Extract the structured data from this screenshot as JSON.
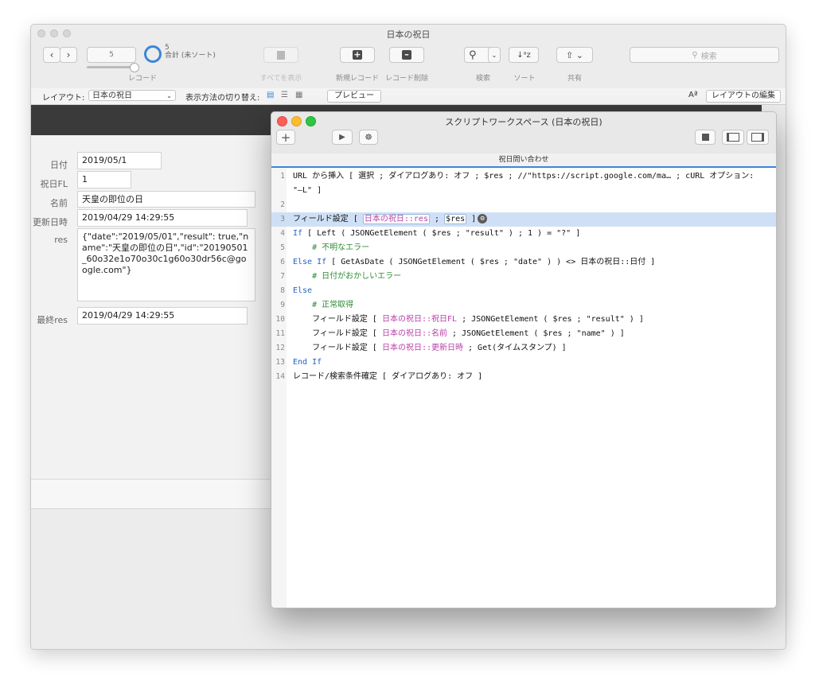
{
  "main_window": {
    "title": "日本の祝日",
    "toolbar": {
      "record_input": "5",
      "record_count": "5",
      "record_sort": "合計 (未ソート)",
      "record_label": "レコード",
      "show_all_label": "すべてを表示",
      "new_record_label": "新規レコード",
      "delete_record_label": "レコード削除",
      "find_label": "検索",
      "sort_label": "ソート",
      "share_label": "共有",
      "search_placeholder": "検索"
    },
    "layout_bar": {
      "layout_label": "レイアウト:",
      "layout_value": "日本の祝日",
      "view_as_label": "表示方法の切り替え:",
      "preview_button": "プレビュー",
      "aa_icon_text": "Aª",
      "edit_layout_button": "レイアウトの編集"
    },
    "form": {
      "date_label": "日付",
      "date_value": "2019/05/1",
      "flag_label": "祝日FL",
      "flag_value": "1",
      "name_label": "名前",
      "name_value": "天皇の即位の日",
      "updated_label": "更新日時",
      "updated_value": "2019/04/29 14:29:55",
      "res_label": "res",
      "res_value": "{\"date\":\"2019/05/01\",\"result\": true,\"name\":\"天皇の即位の日\",\"id\":\"20190501_60o32e1o70o30c1g60o30dr56c@google.com\"}",
      "last_res_label": "最終res",
      "last_res_value": "2019/04/29 14:29:55"
    }
  },
  "script_window": {
    "title": "スクリプトワークスペース (日本の祝日)",
    "tab_label": "祝日問い合わせ",
    "lines": [
      {
        "n": "1",
        "parts": [
          {
            "t": "URL から挿入 [ 選択 ; ダイアログあり: オフ ; $res ; //\"https://script.google.com/ma… ; cURL オプション:",
            "c": ""
          }
        ]
      },
      {
        "n": "",
        "parts": [
          {
            "t": "\"–L\" ]",
            "c": ""
          }
        ]
      },
      {
        "n": "2",
        "parts": []
      },
      {
        "n": "3",
        "parts": [
          {
            "t": "フィールド設定 [ ",
            "c": ""
          },
          {
            "t": "日本の祝日::res",
            "c": "fd box"
          },
          {
            "t": " ; ",
            "c": ""
          },
          {
            "t": "$res",
            "c": "box"
          },
          {
            "t": " ]",
            "c": ""
          }
        ]
      },
      {
        "n": "4",
        "parts": [
          {
            "t": "If",
            "c": "kw"
          },
          {
            "t": " [ Left ( JSONGetElement ( $res ; \"result\" ) ; 1 ) = \"?\" ]",
            "c": ""
          }
        ]
      },
      {
        "n": "5",
        "parts": [
          {
            "t": "    # 不明なエラー",
            "c": "cm"
          }
        ]
      },
      {
        "n": "6",
        "parts": [
          {
            "t": "Else If",
            "c": "kw"
          },
          {
            "t": " [ GetAsDate ( JSONGetElement ( $res ; \"date\" ) ) <> 日本の祝日::日付 ]",
            "c": ""
          }
        ]
      },
      {
        "n": "7",
        "parts": [
          {
            "t": "    # 日付がおかしいエラー",
            "c": "cm"
          }
        ]
      },
      {
        "n": "8",
        "parts": [
          {
            "t": "Else",
            "c": "kw"
          }
        ]
      },
      {
        "n": "9",
        "parts": [
          {
            "t": "    # 正常取得",
            "c": "cm"
          }
        ]
      },
      {
        "n": "10",
        "parts": [
          {
            "t": "    フィールド設定 [ ",
            "c": ""
          },
          {
            "t": "日本の祝日::祝日FL",
            "c": "fd"
          },
          {
            "t": " ; JSONGetElement ( $res ; \"result\" ) ]",
            "c": ""
          }
        ]
      },
      {
        "n": "11",
        "parts": [
          {
            "t": "    フィールド設定 [ ",
            "c": ""
          },
          {
            "t": "日本の祝日::名前",
            "c": "fd"
          },
          {
            "t": " ; JSONGetElement ( $res ; \"name\" ) ]",
            "c": ""
          }
        ]
      },
      {
        "n": "12",
        "parts": [
          {
            "t": "    フィールド設定 [ ",
            "c": ""
          },
          {
            "t": "日本の祝日::更新日時",
            "c": "fd"
          },
          {
            "t": " ; Get(タイムスタンプ) ]",
            "c": ""
          }
        ]
      },
      {
        "n": "13",
        "parts": [
          {
            "t": "End If",
            "c": "kw"
          }
        ]
      },
      {
        "n": "14",
        "parts": [
          {
            "t": "レコード/検索条件確定 [ ダイアログあり: オフ ]",
            "c": ""
          }
        ]
      }
    ],
    "selected_line": "3"
  }
}
